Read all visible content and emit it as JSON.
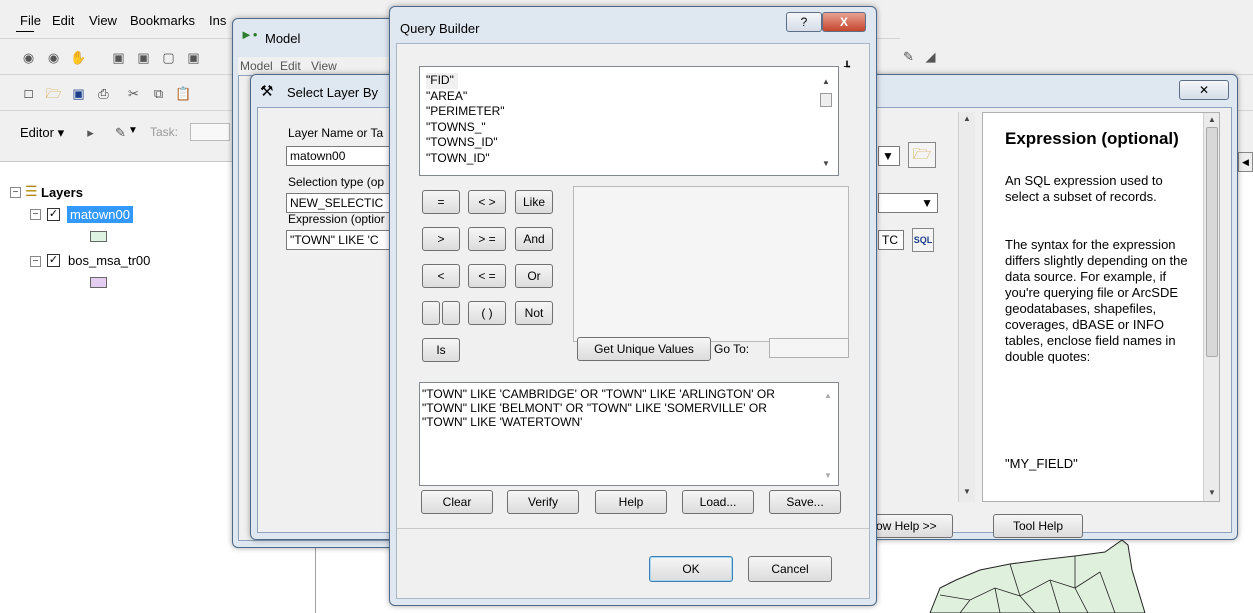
{
  "arcmap": {
    "menu": [
      "File",
      "Edit",
      "View",
      "Bookmarks",
      "Ins"
    ],
    "editor_label": "Editor",
    "task_label": "Task:",
    "toc": {
      "root": "Layers",
      "layers": [
        "matown00",
        "bos_msa_tr00"
      ]
    }
  },
  "model_window": {
    "title": "Model",
    "menu": [
      "Model",
      "Edit",
      "View"
    ]
  },
  "select_layer_window": {
    "title": "Select Layer By",
    "layer_label": "Layer Name or Ta",
    "layer_value": "matown00",
    "selection_label": "Selection type (op",
    "selection_value": "NEW_SELECTIC",
    "expression_label": "Expression (optior",
    "expression_value": "\"TOWN\" LIKE 'C",
    "partial_text": "TC",
    "show_help": "how Help >>",
    "tool_help": "Tool Help",
    "help_title": "Expression (optional)",
    "help_p1": "An SQL expression used to select a subset of records.",
    "help_p2": "The syntax for the expression differs slightly depending on the data source. For example, if you're querying file or ArcSDE geodatabases, shapefiles, coverages, dBASE or INFO tables, enclose field names in double quotes:",
    "help_p3": "\"MY_FIELD\""
  },
  "query_builder": {
    "title": "Query Builder",
    "help_btn": "?",
    "close_btn": "X",
    "fields": [
      "\"FID\"",
      "\"AREA\"",
      "\"PERIMETER\"",
      "\"TOWNS_\"",
      "\"TOWNS_ID\"",
      "\"TOWN_ID\""
    ],
    "operators": {
      "eq": "=",
      "ne": "< >",
      "like": "Like",
      "gt": ">",
      "ge": "> =",
      "and": "And",
      "lt": "<",
      "le": "< =",
      "or": "Or",
      "pct": "",
      "paren": "( )",
      "not": "Not",
      "is": "Is"
    },
    "get_unique": "Get Unique Values",
    "goto_label": "Go To:",
    "expression": "\"TOWN\" LIKE 'CAMBRIDGE' OR \"TOWN\" LIKE 'ARLINGTON' OR \"TOWN\" LIKE 'BELMONT' OR \"TOWN\" LIKE 'SOMERVILLE' OR \"TOWN\" LIKE 'WATERTOWN'",
    "buttons": {
      "clear": "Clear",
      "verify": "Verify",
      "help": "Help",
      "load": "Load...",
      "save": "Save..."
    },
    "ok": "OK",
    "cancel": "Cancel"
  }
}
